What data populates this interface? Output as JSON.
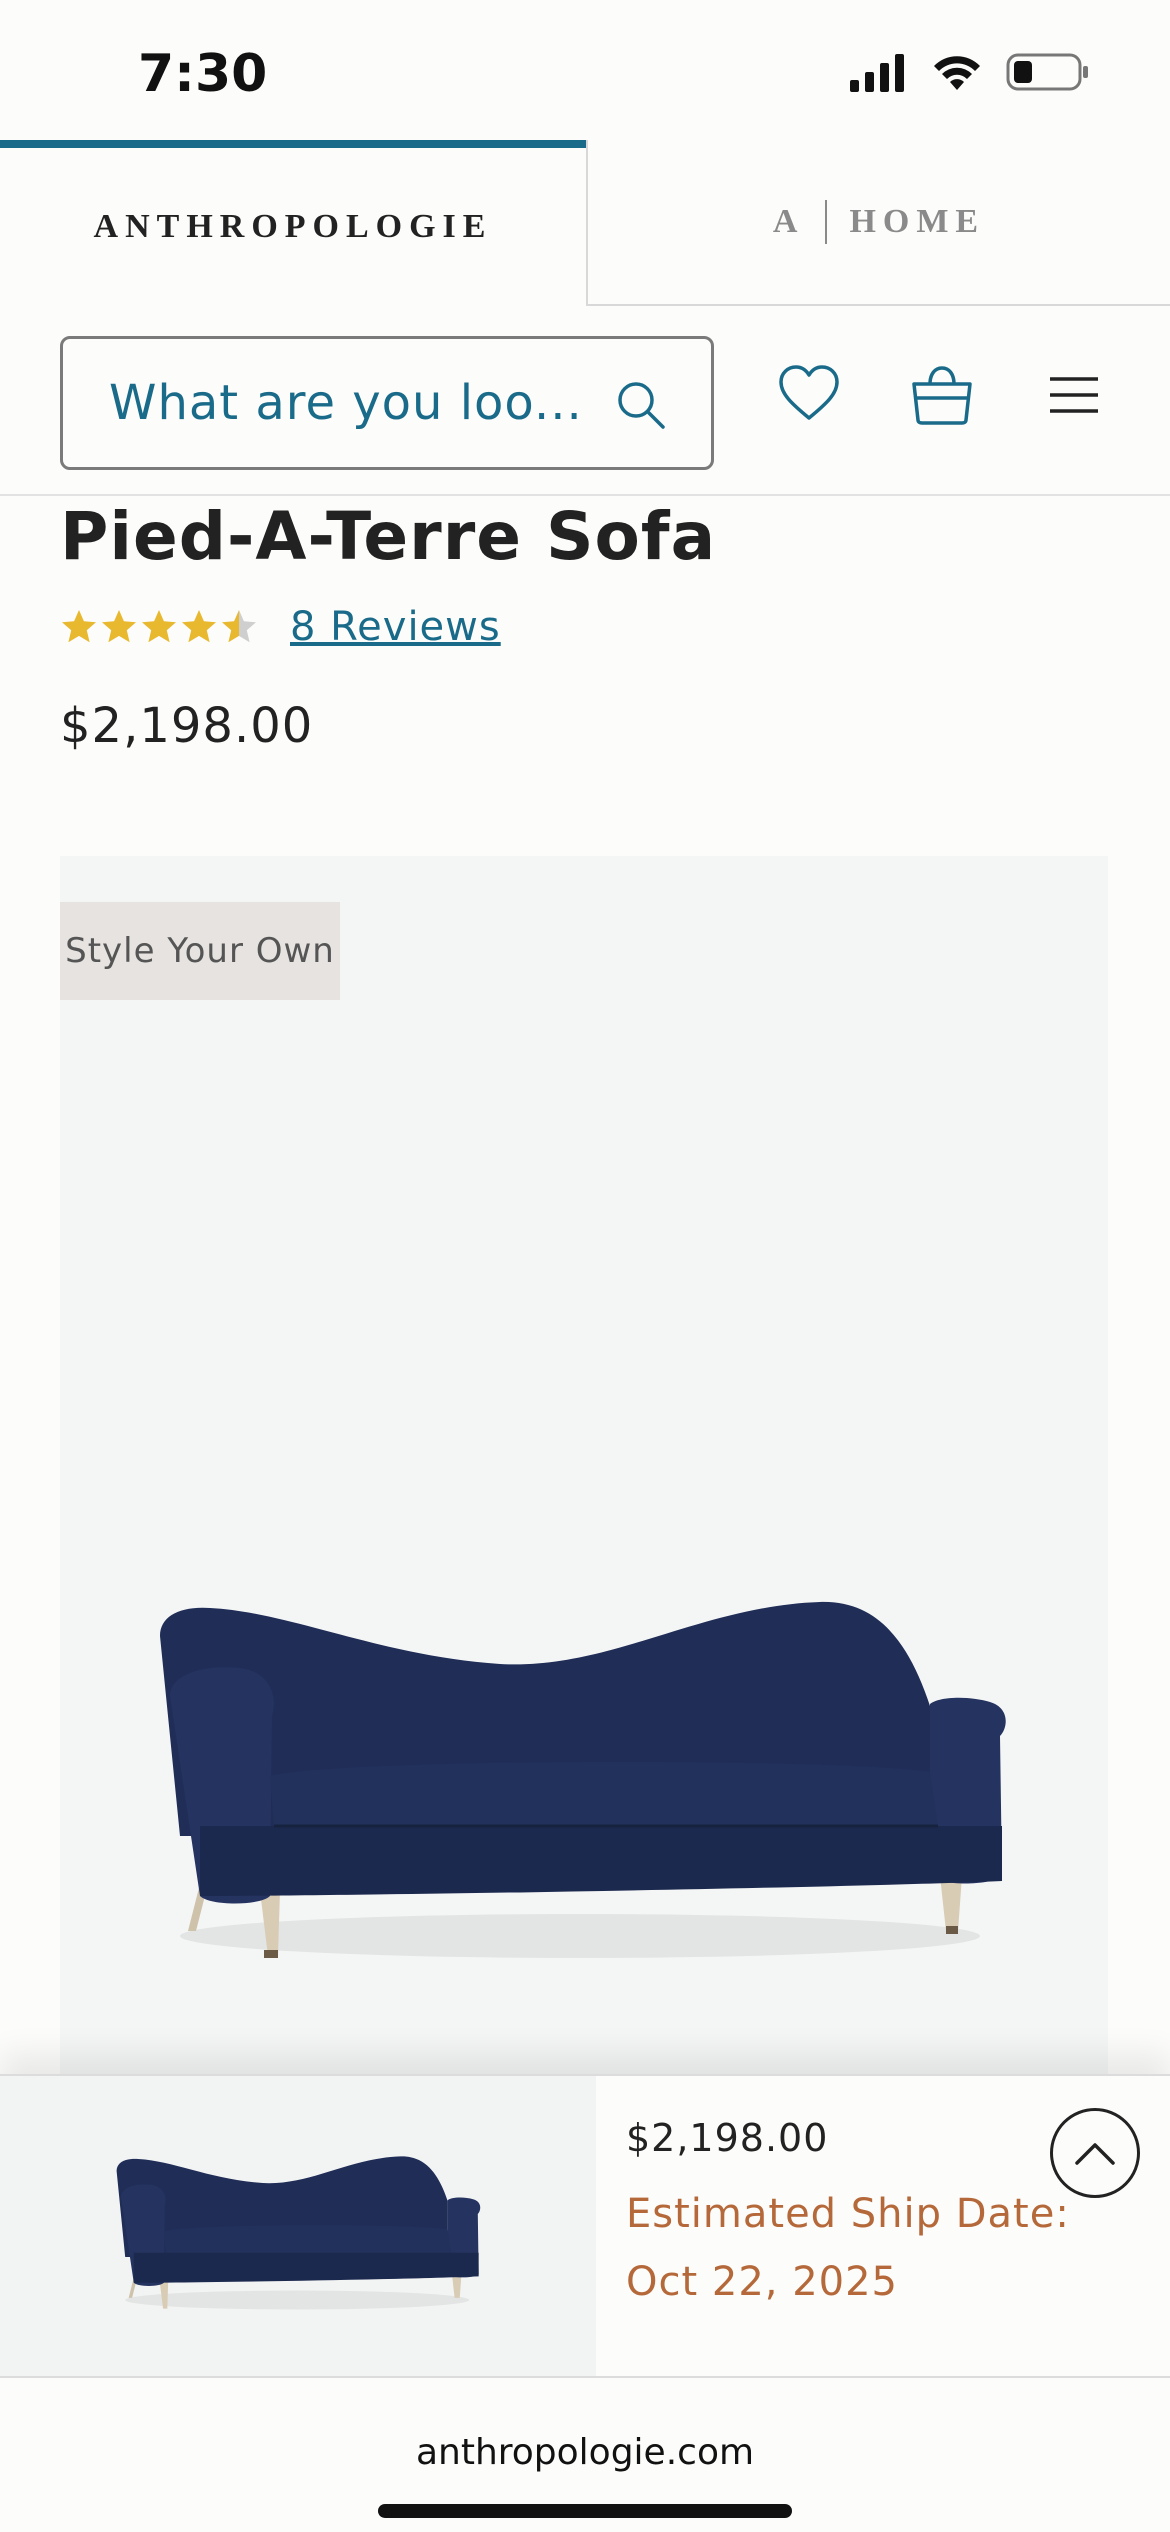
{
  "status_bar": {
    "time": "7:30"
  },
  "brand_tabs": {
    "main_label": "ANTHROPOLOGIE",
    "home_a": "A",
    "home_label": "HOME"
  },
  "header": {
    "search_placeholder": "What are you loo...",
    "wishlist_icon": "heart-icon",
    "bag_icon": "bag-icon",
    "menu_icon": "menu-icon"
  },
  "product": {
    "title": "Pied-A-Terre Sofa",
    "rating": 4.5,
    "rating_max": 5,
    "reviews_label": "8 Reviews",
    "price": "$2,198.00",
    "badge": "Style Your Own",
    "sofa_color": "#1f2d57"
  },
  "sticky_bar": {
    "price": "$2,198.00",
    "ship_date": "Estimated Ship Date: Oct 22, 2025"
  },
  "browser": {
    "url": "anthropologie.com"
  },
  "colors": {
    "accent": "#1a6b8a",
    "ship": "#b5693a",
    "star": "#e8b82e"
  }
}
